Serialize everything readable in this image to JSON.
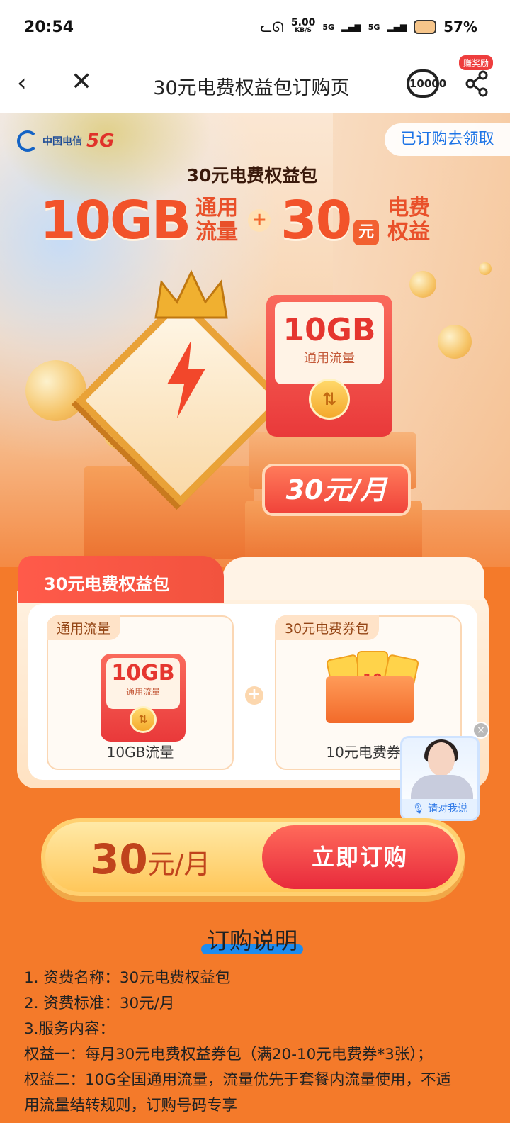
{
  "status": {
    "time": "20:54",
    "net_speed_value": "5.00",
    "net_speed_unit": "KB/S",
    "signal1": "5G",
    "signal2": "5G",
    "battery": "57%"
  },
  "nav": {
    "title": "30元电费权益包订购页",
    "service_label": "10000",
    "reward_badge": "赚奖励"
  },
  "hero": {
    "brand_cn": "中国电信",
    "brand_5g": "5G",
    "claim_label": "已订购去领取",
    "subtitle": "30元电费权益包",
    "headline_gb": "10GB",
    "headline_gb_word1": "通用",
    "headline_gb_word2": "流量",
    "headline_plus": "+",
    "headline_amount": "30",
    "headline_yuan": "元",
    "headline_word1": "电费",
    "headline_word2": "权益",
    "pack_gb": "10GB",
    "pack_sub": "通用流量",
    "price_pill": "30元/月"
  },
  "package": {
    "tab_title": "30元电费权益包",
    "item1_label": "通用流量",
    "item1_gb": "10GB",
    "item1_sub": "通用流量",
    "item1_caption": "10GB流量",
    "item2_label": "30元电费券包",
    "item2_voucher_value": "10",
    "item2_caption": "10元电费券X",
    "plus": "+"
  },
  "assistant": {
    "say_label": "请对我说",
    "close": "×"
  },
  "order": {
    "price_number": "30",
    "price_unit": "元/月",
    "button_label": "立即订购"
  },
  "instructions": {
    "title": "订购说明",
    "lines": [
      "1. 资费名称：30元电费权益包",
      "2. 资费标准：30元/月",
      "3.服务内容：",
      "权益一：每月30元电费权益券包（满20-10元电费券*3张）；",
      "权益二：10G全国通用流量，流量优先于套餐内流量使用，不适",
      "用流量结转规则，订购号码专享"
    ]
  },
  "colors": {
    "accent_red": "#e9393a",
    "page_orange": "#f47a2a",
    "link_blue": "#1d74e6"
  }
}
